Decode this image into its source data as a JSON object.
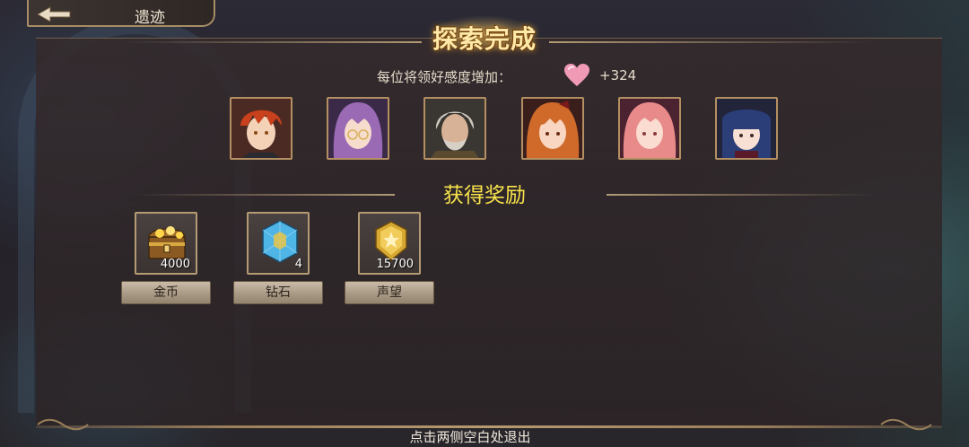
{
  "header": {
    "location_label": "遗迹",
    "title": "探索完成"
  },
  "affection": {
    "label": "每位将领好感度增加：",
    "value": "+324",
    "icon": "heart-icon"
  },
  "portraits": [
    {
      "name": "portrait-red-hair-male",
      "hair": "#c8401c"
    },
    {
      "name": "portrait-purple-hair-glasses",
      "hair": "#9a6ab4"
    },
    {
      "name": "portrait-white-hair-old-man",
      "hair": "#cfcac0"
    },
    {
      "name": "portrait-orange-hair-female",
      "hair": "#d06a2a"
    },
    {
      "name": "portrait-pink-hair-female",
      "hair": "#e88a8a"
    },
    {
      "name": "portrait-navy-hair-female",
      "hair": "#2b3e78"
    }
  ],
  "rewards": {
    "header": "获得奖励",
    "items": [
      {
        "label": "金币",
        "count": "4000",
        "icon": "treasure-chest-icon"
      },
      {
        "label": "钻石",
        "count": "4",
        "icon": "diamond-crystal-icon"
      },
      {
        "label": "声望",
        "count": "15700",
        "icon": "prestige-badge-icon"
      }
    ]
  },
  "footer": {
    "exit_hint": "点击两侧空白处退出"
  },
  "colors": {
    "reward_header": "#f7e34a",
    "frame_gold": "#b48f62",
    "title_glow": "#ffe9a8"
  }
}
